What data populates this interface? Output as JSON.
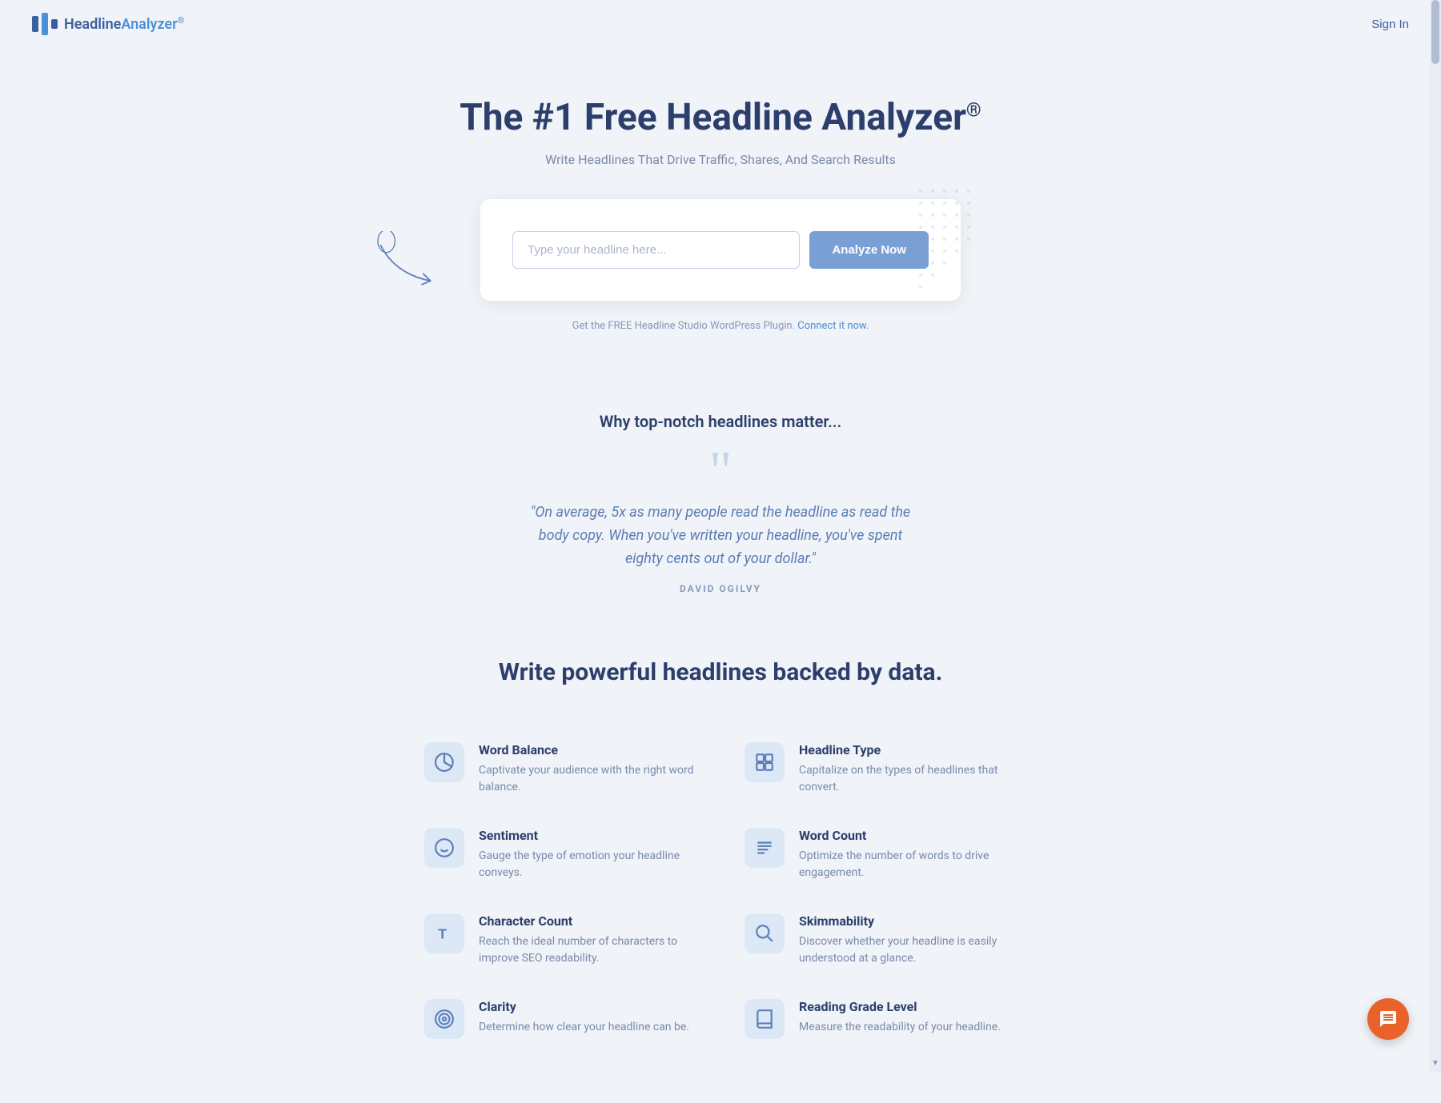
{
  "header": {
    "logo_headline": "Headline",
    "logo_analyzer": "Analyzer",
    "logo_reg": "®",
    "sign_in": "Sign In"
  },
  "hero": {
    "title": "The #1 Free Headline Analyzer",
    "title_reg": "®",
    "subtitle": "Write Headlines That Drive Traffic, Shares, And Search Results",
    "input_placeholder": "Type your headline here...",
    "analyze_button": "Analyze Now",
    "wp_notice_text": "Get the FREE Headline Studio WordPress Plugin.",
    "wp_notice_link": "Connect it now."
  },
  "why_section": {
    "title": "Why top-notch headlines matter...",
    "quote": "\"On average, 5x as many people read the headline as read the body copy. When you've written your headline, you've spent eighty cents out of your dollar.\"",
    "author": "DAVID OGILVY"
  },
  "features_section": {
    "title": "Write powerful headlines backed by data.",
    "features": [
      {
        "id": "word-balance",
        "title": "Word Balance",
        "description": "Captivate your audience with the right word balance.",
        "icon": "pie"
      },
      {
        "id": "headline-type",
        "title": "Headline Type",
        "description": "Capitalize on the types of headlines that convert.",
        "icon": "layout"
      },
      {
        "id": "sentiment",
        "title": "Sentiment",
        "description": "Gauge the type of emotion your headline conveys.",
        "icon": "smile"
      },
      {
        "id": "word-count",
        "title": "Word Count",
        "description": "Optimize the number of words to drive engagement.",
        "icon": "lines"
      },
      {
        "id": "character-count",
        "title": "Character Count",
        "description": "Reach the ideal number of characters to improve SEO readability.",
        "icon": "T"
      },
      {
        "id": "skimmability",
        "title": "Skimmability",
        "description": "Discover whether your headline is easily understood at a glance.",
        "icon": "search"
      },
      {
        "id": "clarity",
        "title": "Clarity",
        "description": "Determine how clear your headline can be.",
        "icon": "target"
      },
      {
        "id": "reading-grade",
        "title": "Reading Grade Level",
        "description": "Measure the readability of your headline.",
        "icon": "book"
      }
    ]
  },
  "colors": {
    "brand_blue": "#3a5fa0",
    "accent_blue": "#4a90d9",
    "icon_bg": "#dce8f5",
    "icon_color": "#5a80b8",
    "chat_bg": "#e8622a"
  }
}
